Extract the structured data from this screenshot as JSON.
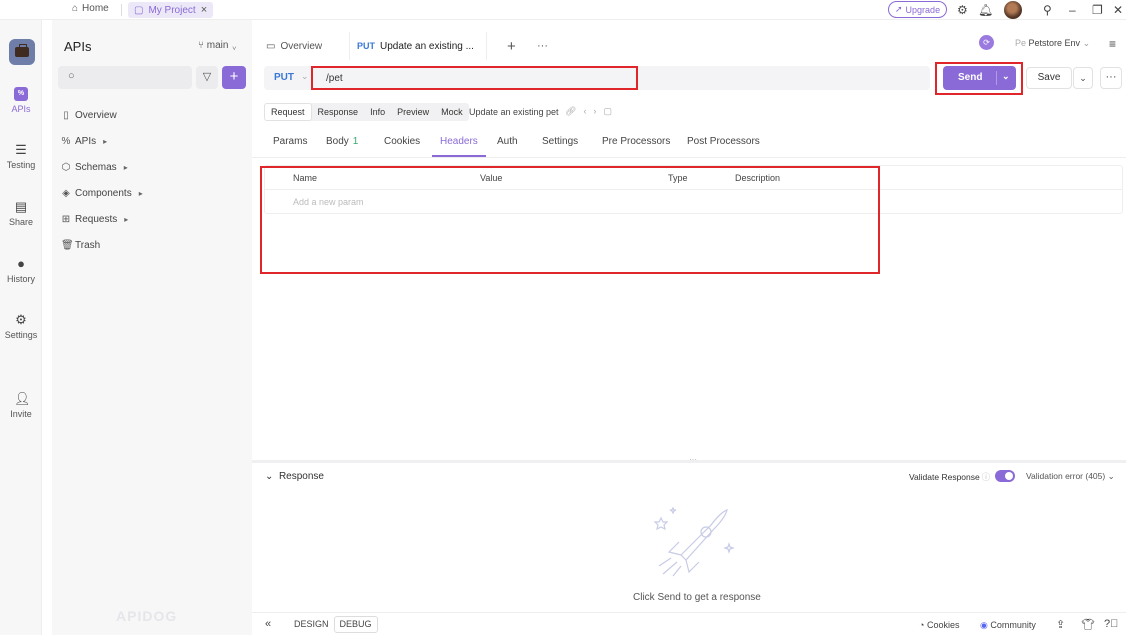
{
  "titlebar": {
    "home_label": "Home",
    "project_tab_label": "My Project",
    "upgrade_label": "Upgrade"
  },
  "rail": {
    "items": [
      {
        "label": "APIs",
        "icon": "apis-icon"
      },
      {
        "label": "Testing",
        "icon": "testing-icon"
      },
      {
        "label": "Share",
        "icon": "share-icon"
      },
      {
        "label": "History",
        "icon": "history-icon"
      },
      {
        "label": "Settings",
        "icon": "settings-icon"
      },
      {
        "label": "Invite",
        "icon": "invite-icon"
      }
    ]
  },
  "sidebar": {
    "title": "APIs",
    "branch": "main",
    "nav": [
      {
        "label": "Overview"
      },
      {
        "label": "APIs"
      },
      {
        "label": "Schemas"
      },
      {
        "label": "Components"
      },
      {
        "label": "Requests"
      },
      {
        "label": "Trash"
      }
    ],
    "brand": "APIDOG"
  },
  "tabs": {
    "overview_label": "Overview",
    "active_method": "PUT",
    "active_label": "Update an existing ...",
    "environment": "Petstore Env",
    "env_prefix": "Pe"
  },
  "request": {
    "method": "PUT",
    "url": "/pet",
    "send_label": "Send",
    "save_label": "Save"
  },
  "segments": {
    "items": [
      "Request",
      "Response",
      "Info",
      "Preview",
      "Mock"
    ],
    "active": "Request",
    "description": "Update an existing pet"
  },
  "subtabs": {
    "params": "Params",
    "body": "Body",
    "body_count": "1",
    "cookies": "Cookies",
    "headers": "Headers",
    "auth": "Auth",
    "settings": "Settings",
    "pre": "Pre Processors",
    "post": "Post Processors",
    "active": "Headers"
  },
  "headers_table": {
    "columns": [
      "Name",
      "Value",
      "Type",
      "Description"
    ],
    "placeholder": "Add a new param"
  },
  "response": {
    "title": "Response",
    "validate_label": "Validate Response",
    "validate_on": true,
    "validation_status": "Validation error (405)",
    "empty_message": "Click Send to get a response"
  },
  "bottombar": {
    "modes": [
      "DESIGN",
      "DEBUG"
    ],
    "active_mode": "DEBUG",
    "cookies_label": "Cookies",
    "community_label": "Community"
  },
  "colors": {
    "accent": "#8a6ad6",
    "method_put": "#3a78d6",
    "highlight": "#e0262b"
  }
}
